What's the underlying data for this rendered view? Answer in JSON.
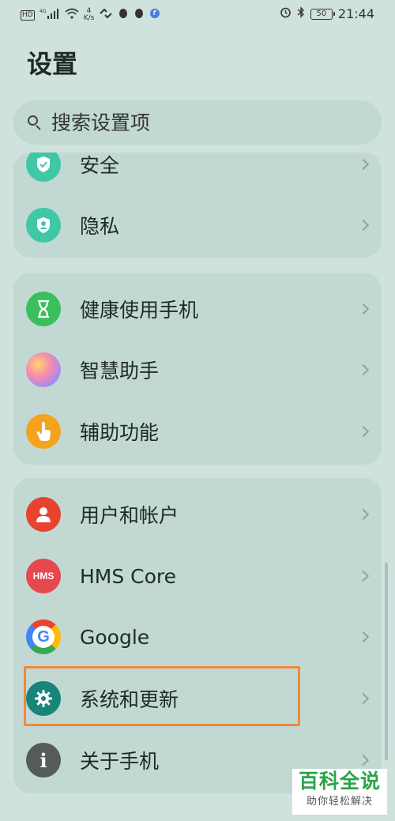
{
  "status_bar": {
    "hd": "HD",
    "signal": "4G",
    "net_speed_value": "4",
    "net_speed_unit": "K/s",
    "battery": "50",
    "time": "21:44"
  },
  "page": {
    "title": "设置"
  },
  "search": {
    "placeholder": "搜索设置项"
  },
  "groups": [
    {
      "items": [
        {
          "label": "安全",
          "icon": "shield-check-icon",
          "color": "#3fc7a6"
        },
        {
          "label": "隐私",
          "icon": "privacy-shield-icon",
          "color": "#3fc7a6"
        }
      ]
    },
    {
      "items": [
        {
          "label": "健康使用手机",
          "icon": "hourglass-icon",
          "color": "#39c05a"
        },
        {
          "label": "智慧助手",
          "icon": "assistant-orb-icon",
          "color": "#c79df0"
        },
        {
          "label": "辅助功能",
          "icon": "hand-pointer-icon",
          "color": "#f5a21f"
        }
      ]
    },
    {
      "items": [
        {
          "label": "用户和帐户",
          "icon": "user-icon",
          "color": "#e8432f"
        },
        {
          "label": "HMS Core",
          "icon": "hms-core-icon",
          "icon_text": "HMS",
          "color": "#e5484d"
        },
        {
          "label": "Google",
          "icon": "google-icon",
          "icon_text": "G",
          "color": "#ffffff"
        },
        {
          "label": "系统和更新",
          "icon": "gear-icon",
          "color": "#17857a"
        },
        {
          "label": "关于手机",
          "icon": "info-icon",
          "icon_text": "i",
          "color": "#555b5a"
        }
      ]
    }
  ],
  "watermark": {
    "main": "百科全说",
    "sub": "助你轻松解决"
  }
}
